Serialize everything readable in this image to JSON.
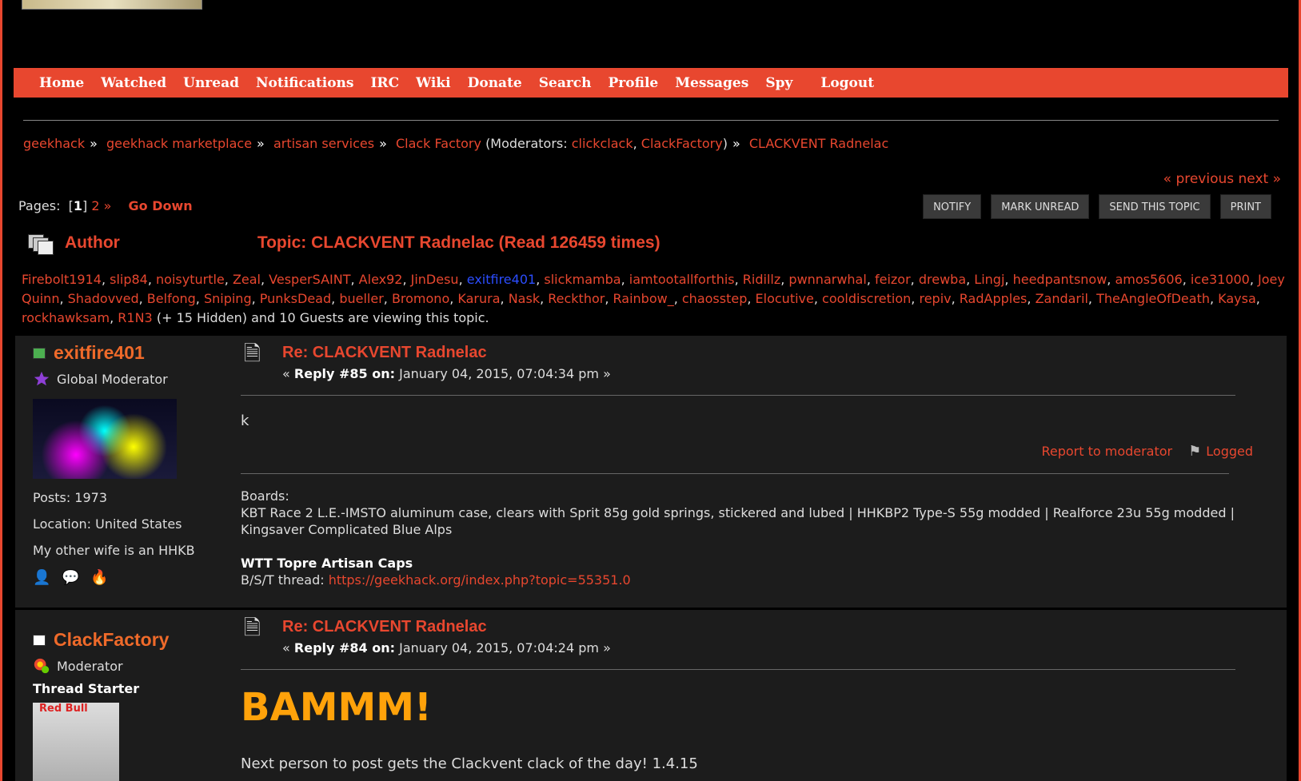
{
  "nav": {
    "items": [
      "Home",
      "Watched",
      "Unread",
      "Notifications",
      "IRC",
      "Wiki",
      "Donate",
      "Search",
      "Profile",
      "Messages",
      "Spy"
    ],
    "logout": "Logout"
  },
  "breadcrumb": {
    "items": [
      "geekhack",
      "geekhack marketplace",
      "artisan services",
      "Clack Factory"
    ],
    "moderators_prefix": "(Moderators:",
    "moderators": [
      "clickclack",
      "ClackFactory"
    ],
    "moderators_suffix": ")",
    "current": "CLACKVENT Radnelac"
  },
  "prevnext": "« previous next »",
  "pages": {
    "label": "Pages:",
    "current": "1",
    "next_page": "2",
    "next_arrow": "»",
    "go_down": "Go Down"
  },
  "buttons": [
    "NOTIFY",
    "MARK UNREAD",
    "SEND THIS TOPIC",
    "PRINT"
  ],
  "topic_header": {
    "author_label": "Author",
    "title": "Topic: CLACKVENT Radnelac  (Read 126459 times)"
  },
  "viewers": {
    "names": [
      "Firebolt1914",
      "slip84",
      "noisyturtle",
      "Zeal",
      "VesperSAINT",
      "Alex92",
      "JinDesu",
      "exitfire401",
      "slickmamba",
      "iamtootallforthis",
      "Ridillz",
      "pwnnarwhal",
      "feizor",
      "drewba",
      "Lingj",
      "heedpantsnow",
      "amos5606",
      "ice31000",
      "Joey Quinn",
      "Shadovved",
      "Belfong",
      "Sniping",
      "PunksDead",
      "bueller",
      "Bromono",
      "Karura",
      "Nask",
      "Reckthor",
      "Rainbow_",
      "chaosstep",
      "Elocutive",
      "cooldiscretion",
      "repiv",
      "RadApples",
      "Zandaril",
      "TheAngleOfDeath",
      "Kaysa",
      "rockhawksam",
      "R1N3"
    ],
    "highlighted": "exitfire401",
    "suffix": "(+ 15 Hidden) and 10 Guests are viewing this topic."
  },
  "posts": [
    {
      "username": "exitfire401",
      "status_color": "#4caf50",
      "role": "Global Moderator",
      "posts": "Posts: 1973",
      "location": "Location: United States",
      "personal_text": "My other wife is an HHKB",
      "subject": "Re: CLACKVENT Radnelac",
      "reply_prefix": "«",
      "reply_label": "Reply #85 on:",
      "reply_date": "January 04, 2015, 07:04:34 pm »",
      "message": "k",
      "report": "Report to moderator",
      "logged": "Logged",
      "sig_label": "Boards:",
      "sig_boards": "KBT Race 2 L.E.-IMSTO aluminum case, clears with Sprit 85g gold springs, stickered and lubed | HHKBP2 Type-S 55g modded | Realforce 23u 55g modded | Kingsaver Complicated Blue Alps",
      "sig_wtt": "WTT Topre Artisan Caps",
      "sig_bst_label": "B/S/T thread:",
      "sig_bst_link": "https://geekhack.org/index.php?topic=55351.0"
    },
    {
      "username": "ClackFactory",
      "status_color": "#ffffff",
      "role": "Moderator",
      "thread_starter": "Thread Starter",
      "avatar_text": "Red Bull",
      "subject": "Re: CLACKVENT Radnelac",
      "reply_prefix": "«",
      "reply_label": "Reply #84 on:",
      "reply_date": "January 04, 2015, 07:04:24 pm »",
      "headline": "BAMMM!",
      "message": "Next person to post gets the Clackvent clack of the day!  1.4.15"
    }
  ],
  "colors": {
    "accent": "#e8472f",
    "username": "#ef6a2a",
    "highlight_user": "#2b4dff",
    "bammm": "#ffa20a"
  }
}
